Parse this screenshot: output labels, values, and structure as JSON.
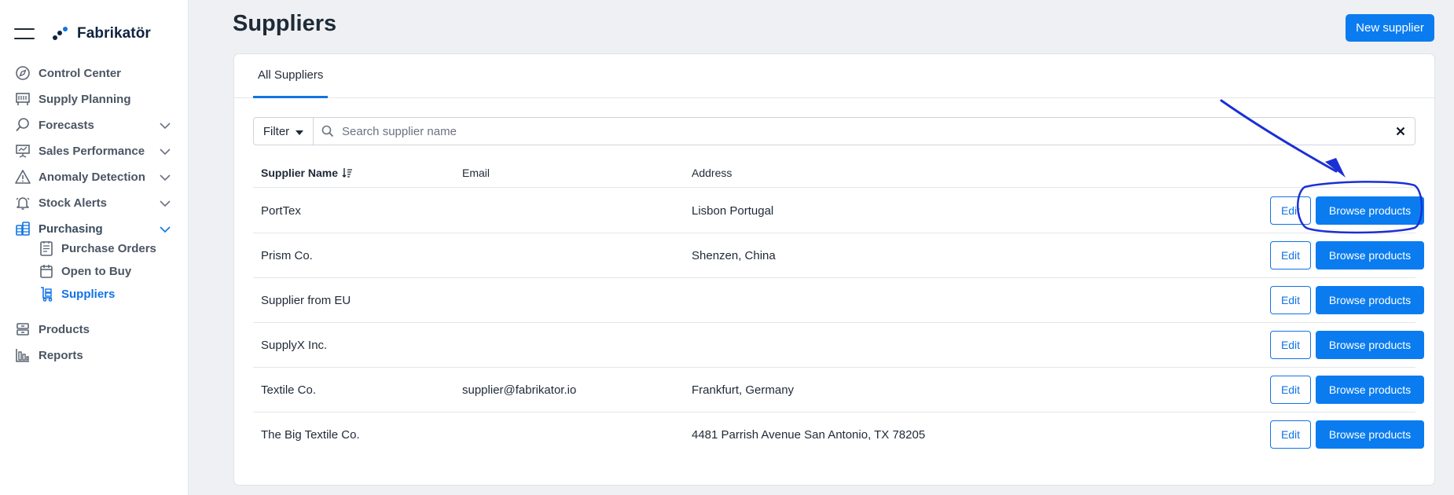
{
  "brand": {
    "name": "Fabrikatör"
  },
  "nav": {
    "items": [
      {
        "label": "Control Center"
      },
      {
        "label": "Supply Planning"
      },
      {
        "label": "Forecasts"
      },
      {
        "label": "Sales Performance"
      },
      {
        "label": "Anomaly Detection"
      },
      {
        "label": "Stock Alerts"
      },
      {
        "label": "Purchasing"
      },
      {
        "label": "Products"
      },
      {
        "label": "Reports"
      }
    ],
    "purchasing_sub": [
      {
        "label": "Purchase Orders"
      },
      {
        "label": "Open to Buy"
      },
      {
        "label": "Suppliers"
      }
    ]
  },
  "header": {
    "title": "Suppliers",
    "new_button_label": "New supplier"
  },
  "tabs": [
    {
      "label": "All Suppliers"
    }
  ],
  "search": {
    "filter_label": "Filter",
    "placeholder": "Search supplier name",
    "value": ""
  },
  "table": {
    "columns": {
      "name": "Supplier Name",
      "email": "Email",
      "address": "Address"
    },
    "edit_label": "Edit",
    "browse_label": "Browse products",
    "rows": [
      {
        "name": "PortTex",
        "email": "",
        "address": "Lisbon Portugal"
      },
      {
        "name": "Prism Co.",
        "email": "",
        "address": "Shenzen, China"
      },
      {
        "name": "Supplier from EU",
        "email": "",
        "address": ""
      },
      {
        "name": "SupplyX Inc.",
        "email": "",
        "address": ""
      },
      {
        "name": "Textile Co.",
        "email": "supplier@fabrikator.io",
        "address": "Frankfurt, Germany"
      },
      {
        "name": "The Big Textile Co.",
        "email": "",
        "address": "4481 Parrish Avenue San Antonio, TX 78205"
      }
    ]
  },
  "colors": {
    "accent": "#0a7cf0",
    "annotation": "#1b2fd6"
  }
}
